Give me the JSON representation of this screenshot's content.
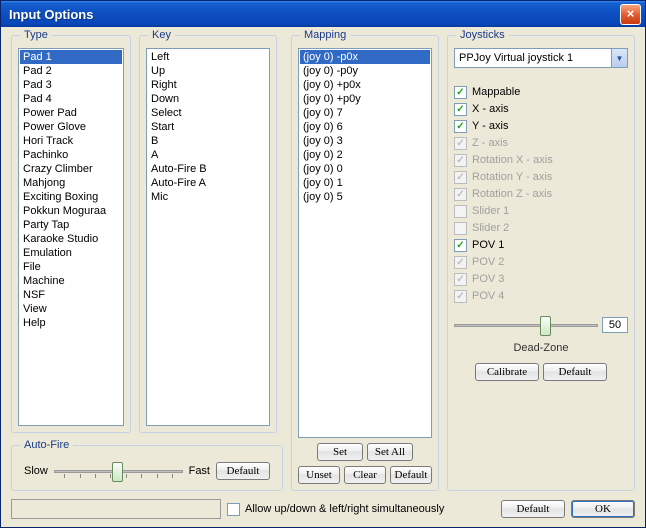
{
  "window": {
    "title": "Input Options"
  },
  "type": {
    "legend": "Type",
    "items": [
      "Pad 1",
      "Pad 2",
      "Pad 3",
      "Pad 4",
      "Power Pad",
      "Power Glove",
      "Hori Track",
      "Pachinko",
      "Crazy Climber",
      "Mahjong",
      "Exciting Boxing",
      "Pokkun Moguraa",
      "Party Tap",
      "Karaoke Studio",
      "Emulation",
      "File",
      "Machine",
      "NSF",
      "View",
      "Help"
    ],
    "selected": 0
  },
  "key": {
    "legend": "Key",
    "items": [
      "Left",
      "Up",
      "Right",
      "Down",
      "Select",
      "Start",
      "B",
      "A",
      "Auto-Fire B",
      "Auto-Fire A",
      "Mic"
    ]
  },
  "mapping": {
    "legend": "Mapping",
    "items": [
      "(joy 0) -p0x",
      "(joy 0) -p0y",
      "(joy 0) +p0x",
      "(joy 0) +p0y",
      "(joy 0) 7",
      "(joy 0) 6",
      "(joy 0) 3",
      "(joy 0) 2",
      "(joy 0) 0",
      "(joy 0) 1",
      "(joy 0) 5"
    ],
    "selected": 0,
    "buttons": {
      "set": "Set",
      "setall": "Set All",
      "unset": "Unset",
      "clear": "Clear",
      "def": "Default"
    }
  },
  "joysticks": {
    "legend": "Joysticks",
    "selected": "PPJoy Virtual joystick 1",
    "checks": [
      {
        "label": "Mappable",
        "checked": true,
        "enabled": true
      },
      {
        "label": "X - axis",
        "checked": true,
        "enabled": true
      },
      {
        "label": "Y - axis",
        "checked": true,
        "enabled": true
      },
      {
        "label": "Z - axis",
        "checked": true,
        "enabled": false
      },
      {
        "label": "Rotation X - axis",
        "checked": true,
        "enabled": false
      },
      {
        "label": "Rotation Y - axis",
        "checked": true,
        "enabled": false
      },
      {
        "label": "Rotation Z - axis",
        "checked": true,
        "enabled": false
      },
      {
        "label": "Slider 1",
        "checked": false,
        "enabled": false
      },
      {
        "label": "Slider 2",
        "checked": false,
        "enabled": false
      },
      {
        "label": "POV 1",
        "checked": true,
        "enabled": true
      },
      {
        "label": "POV 2",
        "checked": true,
        "enabled": false
      },
      {
        "label": "POV 3",
        "checked": true,
        "enabled": false
      },
      {
        "label": "POV 4",
        "checked": true,
        "enabled": false
      }
    ],
    "deadzone_value": "50",
    "deadzone_label": "Dead-Zone",
    "buttons": {
      "calibrate": "Calibrate",
      "def": "Default"
    }
  },
  "autofire": {
    "legend": "Auto-Fire",
    "slow": "Slow",
    "fast": "Fast",
    "def": "Default",
    "position": 0.5
  },
  "bottom": {
    "allow_label": "Allow up/down & left/right simultaneously",
    "allow_checked": false,
    "def": "Default",
    "ok": "OK"
  }
}
